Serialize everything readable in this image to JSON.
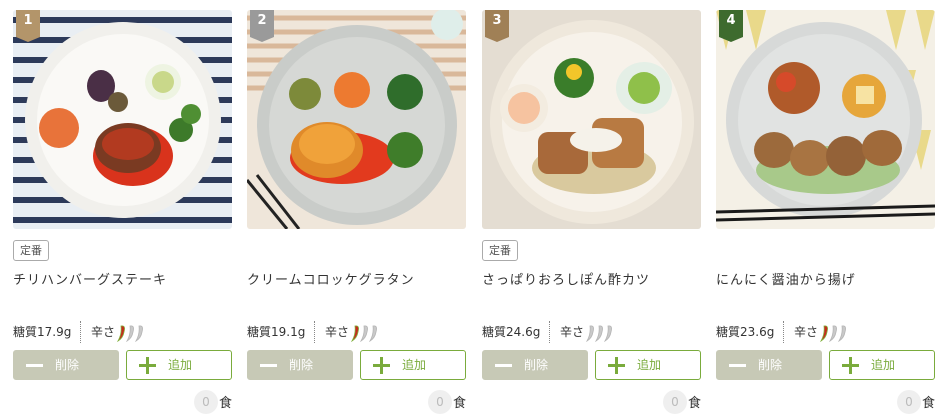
{
  "products": [
    {
      "rank": "1",
      "badge": "定番",
      "name": "チリハンバーグステーキ",
      "carb": "糖質17.9g",
      "spicy_label": "辛さ",
      "spicy_level": 1,
      "spicy_max": 3,
      "delete_label": "削除",
      "add_label": "追加",
      "qty": "0",
      "unit": "食",
      "image": "chili-hamburg-steak-photo"
    },
    {
      "rank": "2",
      "badge": "",
      "name": "クリームコロッケグラタン",
      "carb": "糖質19.1g",
      "spicy_label": "辛さ",
      "spicy_level": 1,
      "spicy_max": 3,
      "delete_label": "削除",
      "add_label": "追加",
      "qty": "0",
      "unit": "食",
      "image": "cream-croquette-gratin-photo"
    },
    {
      "rank": "3",
      "badge": "定番",
      "name": "さっぱりおろしぽん酢カツ",
      "carb": "糖質24.6g",
      "spicy_label": "辛さ",
      "spicy_level": 0,
      "spicy_max": 3,
      "delete_label": "削除",
      "add_label": "追加",
      "qty": "0",
      "unit": "食",
      "image": "grated-ponzu-cutlet-photo"
    },
    {
      "rank": "4",
      "badge": "",
      "name": "にんにく醤油から揚げ",
      "carb": "糖質23.6g",
      "spicy_label": "辛さ",
      "spicy_level": 1,
      "spicy_max": 3,
      "delete_label": "削除",
      "add_label": "追加",
      "qty": "0",
      "unit": "食",
      "image": "garlic-soy-karaage-photo"
    }
  ],
  "colors": {
    "add_green": "#7aab3c",
    "delete_gray": "#c7c9b6",
    "pepper_active": "#c62b1e",
    "pepper_inactive": "#c9c9c9"
  }
}
